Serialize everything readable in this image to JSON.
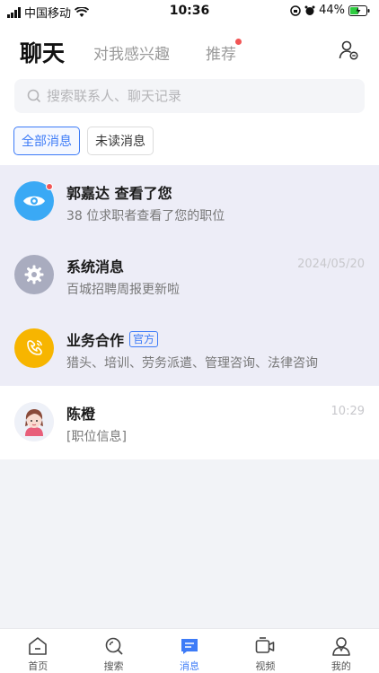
{
  "status_bar": {
    "carrier": "中国移动",
    "time": "10:36",
    "battery": "44%"
  },
  "header": {
    "tabs": [
      {
        "label": "聊天",
        "active": true
      },
      {
        "label": "对我感兴趣",
        "active": false
      },
      {
        "label": "推荐",
        "active": false,
        "has_dot": true
      }
    ]
  },
  "search": {
    "placeholder": "搜索联系人、聊天记录",
    "value": ""
  },
  "filters": [
    {
      "label": "全部消息",
      "selected": true
    },
    {
      "label": "未读消息",
      "selected": false
    }
  ],
  "conversations": [
    {
      "name": "郭嘉达 查看了您",
      "preview": "38 位求职者查看了您的职位",
      "time": "",
      "icon": "eye-icon",
      "color": "#3aa9f5",
      "unread": true
    },
    {
      "name": "系统消息",
      "preview": "百城招聘周报更新啦",
      "time": "2024/05/20",
      "icon": "gear-icon",
      "color": "#a9acbf"
    },
    {
      "name": "业务合作",
      "badge": "官方",
      "preview": "猎头、培训、劳务派遣、管理咨询、法律咨询",
      "time": "",
      "icon": "handshake-icon",
      "color": "#f7b500"
    },
    {
      "name": "陈橙",
      "preview": "[职位信息]",
      "time": "10:29",
      "icon": "user-avatar",
      "color": "#f4e9ee"
    }
  ],
  "tabbar": [
    {
      "label": "首页",
      "icon": "home-icon",
      "active": false
    },
    {
      "label": "搜索",
      "icon": "search-icon",
      "active": false
    },
    {
      "label": "消息",
      "icon": "message-icon",
      "active": true
    },
    {
      "label": "视频",
      "icon": "video-icon",
      "active": false
    },
    {
      "label": "我的",
      "icon": "profile-icon",
      "active": false
    }
  ],
  "colors": {
    "accent": "#3d7bf7",
    "unread_dot": "#f25555",
    "highlight_bg": "#ededf7"
  }
}
